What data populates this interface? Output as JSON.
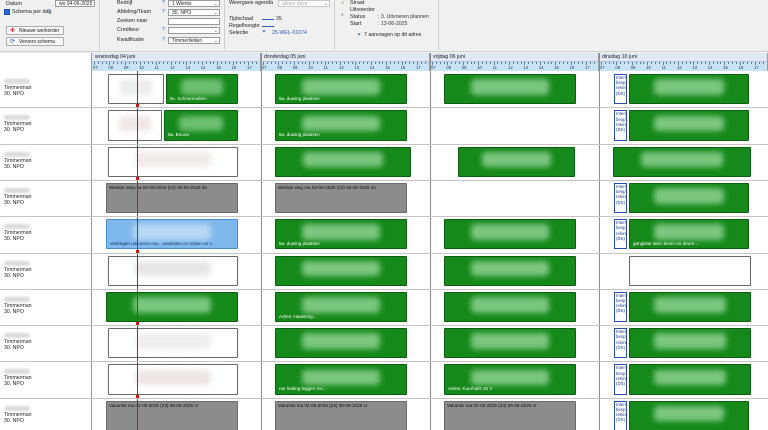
{
  "filters": {
    "datum_label": "Datum",
    "datum_value": "wo 04-06-2025",
    "schema_per_dag_label": "Schema per dag",
    "schema_per_dag_value": "?",
    "nieuwe_werkorder_label": "Nieuwe werkorder",
    "ververs_schema_label": "Ververs schema",
    "bedrijf_label": "Bedrijf",
    "bedrijf_value": "1 Wients",
    "afdeling_label": "Afdeling/Team",
    "afdeling_value": "30. NPO",
    "zoeken_naar_label": "Zoeken naar",
    "crediteur_label": "Crediteur",
    "kwalificatie_label": "Kwalificatie",
    "kwalificatie_value": "Timmerlieden",
    "weergave_agenda_label": "Weergave agenda",
    "weergave_agenda_value": "alleen deze",
    "tijdschaal_label": "Tijdschaal",
    "tijdschaal_value": "35",
    "regelhoogte_label": "Regelhoogte",
    "selectie_label": "Selectie",
    "selectie_value": "25-WEL-01674",
    "straat_label": "Straat",
    "uitvoerder_label": "Uitvoerder",
    "status_label": "Status",
    "status_value": ": 3. Uitvoeren plannen",
    "start_label": "Start",
    "start_value": ": 13-06-2025",
    "aanvragen_label": "7 aanvragen op dit adres"
  },
  "days": [
    {
      "label": "woensdag 04 juni"
    },
    {
      "label": "donderdag 05 juni"
    },
    {
      "label": "vrijdag 06 juni"
    },
    {
      "label": "dinsdag 10 juni"
    }
  ],
  "ruler_hours": [
    "07",
    "08",
    "09",
    "10",
    "11",
    "12",
    "13",
    "14",
    "15",
    "16",
    "17"
  ],
  "employees": [
    {
      "role": "Timmerman",
      "team": "30. NPO"
    },
    {
      "role": "Timmerman",
      "team": "30. NPO"
    },
    {
      "role": "Timmerman",
      "team": "30. NPO"
    },
    {
      "role": "Timmerman",
      "team": "30. NPO"
    },
    {
      "role": "Timmerman",
      "team": "30. NPO"
    },
    {
      "role": "Timmerman",
      "team": "30. NPO"
    },
    {
      "role": "Timmerman",
      "team": "30. NPO"
    },
    {
      "role": "Timmerman",
      "team": "30. NPO"
    },
    {
      "role": "Timmerman",
      "team": "30. NPO"
    },
    {
      "role": "Timmerman",
      "team": "30. NPO"
    }
  ],
  "bars": {
    "r0d0": "5c. Schoonmaken",
    "r0d1": "5a. duwing plaatsen",
    "r1d0": "5a. Bouwv",
    "r1d1": "5a. duwing plaatsen",
    "r3d0": "Weekje weg ma 02-06-2025 (23) 06-06-2025 do",
    "r3d1": "Weekje weg ma 02-06-2025 (23) 06-06-2025 do",
    "r4d0": "verkingen uitvoeren nar... wankklen en toilten en t...",
    "r4d1": "5a. duwing plaatsen",
    "r4d3": "gangklok laten leven en deure...",
    "r6d1": "Adres: Haalsting...",
    "r8d2": "Adres: Kuurhalis 25 V",
    "r8d1": "nar leiding leggen rec...",
    "r9d0": "Vakantie ma 02-06-2025 (23) 06-06-2025 vr",
    "r9d1": "Vakantie ma 02-06-2025 (23) 06-06-2025 vr",
    "r9d2": "Vakantie ma 02-06-2025 (23) 06-06-2025 vr"
  },
  "intern_label": "Intern\nbesp\nreking\n(DS)",
  "colors": {
    "job_green": "#15891a",
    "absence_grey": "#8c8c8c",
    "selected_blue": "#7fb8ec",
    "intern_border": "#2a4fa8",
    "now_line": "#cc1515",
    "header_blue": "#c8e2f6"
  }
}
